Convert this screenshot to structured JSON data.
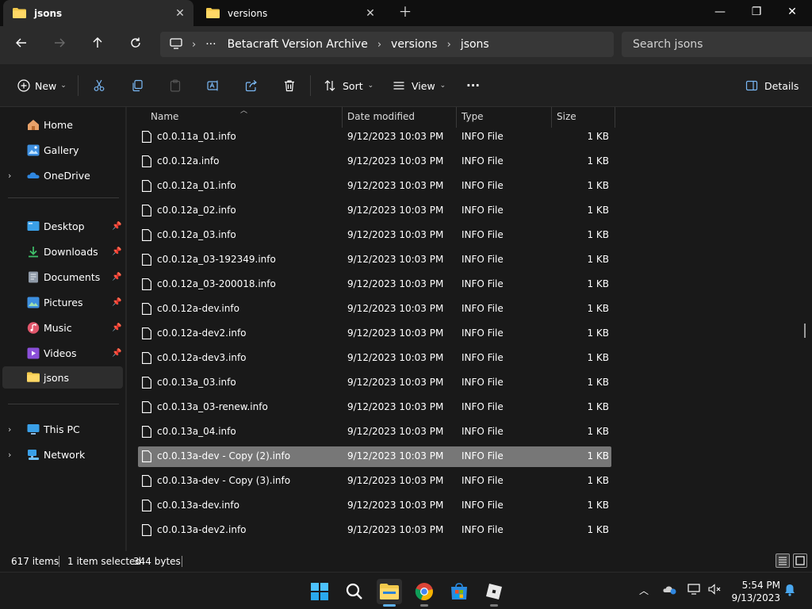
{
  "tabs": [
    {
      "label": "jsons",
      "active": true
    },
    {
      "label": "versions",
      "active": false
    }
  ],
  "window": {
    "minimize": "—",
    "maximize": "❐",
    "close": "✕"
  },
  "breadcrumb": {
    "ellipsis": "···",
    "items": [
      "Betacraft Version Archive",
      "versions",
      "jsons"
    ]
  },
  "search": {
    "placeholder": "Search jsons"
  },
  "toolbar": {
    "new_label": "New",
    "sort_label": "Sort",
    "view_label": "View",
    "more_label": "···",
    "details_label": "Details"
  },
  "sidebar": {
    "top": [
      {
        "label": "Home",
        "icon": "home-icon"
      },
      {
        "label": "Gallery",
        "icon": "gallery-icon"
      },
      {
        "label": "OneDrive",
        "icon": "onedrive-icon",
        "expandable": true
      }
    ],
    "quick_access": [
      {
        "label": "Desktop",
        "icon": "desktop-icon",
        "pinned": true
      },
      {
        "label": "Downloads",
        "icon": "downloads-icon",
        "pinned": true
      },
      {
        "label": "Documents",
        "icon": "documents-icon",
        "pinned": true
      },
      {
        "label": "Pictures",
        "icon": "pictures-icon",
        "pinned": true
      },
      {
        "label": "Music",
        "icon": "music-icon",
        "pinned": true
      },
      {
        "label": "Videos",
        "icon": "videos-icon",
        "pinned": true
      },
      {
        "label": "jsons",
        "icon": "folder-icon",
        "selected": true
      }
    ],
    "bottom": [
      {
        "label": "This PC",
        "icon": "this-pc-icon",
        "expandable": true
      },
      {
        "label": "Network",
        "icon": "network-icon",
        "expandable": true
      }
    ]
  },
  "columns": {
    "name": "Name",
    "date": "Date modified",
    "type": "Type",
    "size": "Size"
  },
  "files": [
    {
      "name": "c0.0.11a_01.info",
      "date": "9/12/2023 10:03 PM",
      "type": "INFO File",
      "size": "1 KB"
    },
    {
      "name": "c0.0.12a.info",
      "date": "9/12/2023 10:03 PM",
      "type": "INFO File",
      "size": "1 KB"
    },
    {
      "name": "c0.0.12a_01.info",
      "date": "9/12/2023 10:03 PM",
      "type": "INFO File",
      "size": "1 KB"
    },
    {
      "name": "c0.0.12a_02.info",
      "date": "9/12/2023 10:03 PM",
      "type": "INFO File",
      "size": "1 KB"
    },
    {
      "name": "c0.0.12a_03.info",
      "date": "9/12/2023 10:03 PM",
      "type": "INFO File",
      "size": "1 KB"
    },
    {
      "name": "c0.0.12a_03-192349.info",
      "date": "9/12/2023 10:03 PM",
      "type": "INFO File",
      "size": "1 KB"
    },
    {
      "name": "c0.0.12a_03-200018.info",
      "date": "9/12/2023 10:03 PM",
      "type": "INFO File",
      "size": "1 KB"
    },
    {
      "name": "c0.0.12a-dev.info",
      "date": "9/12/2023 10:03 PM",
      "type": "INFO File",
      "size": "1 KB"
    },
    {
      "name": "c0.0.12a-dev2.info",
      "date": "9/12/2023 10:03 PM",
      "type": "INFO File",
      "size": "1 KB"
    },
    {
      "name": "c0.0.12a-dev3.info",
      "date": "9/12/2023 10:03 PM",
      "type": "INFO File",
      "size": "1 KB"
    },
    {
      "name": "c0.0.13a_03.info",
      "date": "9/12/2023 10:03 PM",
      "type": "INFO File",
      "size": "1 KB"
    },
    {
      "name": "c0.0.13a_03-renew.info",
      "date": "9/12/2023 10:03 PM",
      "type": "INFO File",
      "size": "1 KB"
    },
    {
      "name": "c0.0.13a_04.info",
      "date": "9/12/2023 10:03 PM",
      "type": "INFO File",
      "size": "1 KB"
    },
    {
      "name": "c0.0.13a-dev - Copy (2).info",
      "date": "9/12/2023 10:03 PM",
      "type": "INFO File",
      "size": "1 KB",
      "selected": true
    },
    {
      "name": "c0.0.13a-dev - Copy (3).info",
      "date": "9/12/2023 10:03 PM",
      "type": "INFO File",
      "size": "1 KB"
    },
    {
      "name": "c0.0.13a-dev.info",
      "date": "9/12/2023 10:03 PM",
      "type": "INFO File",
      "size": "1 KB"
    },
    {
      "name": "c0.0.13a-dev2.info",
      "date": "9/12/2023 10:03 PM",
      "type": "INFO File",
      "size": "1 KB"
    }
  ],
  "status": {
    "count": "617 items",
    "selection": "1 item selected",
    "size": "344 bytes"
  },
  "taskbar": {
    "apps": [
      "start-icon",
      "search-icon",
      "file-explorer-icon",
      "chrome-icon",
      "store-icon",
      "roblox-icon"
    ],
    "time": "5:54 PM",
    "date": "9/13/2023"
  },
  "colors": {
    "accent": "#5fb2f2",
    "folder": "#f2c94c",
    "selected_row": "#777777"
  }
}
